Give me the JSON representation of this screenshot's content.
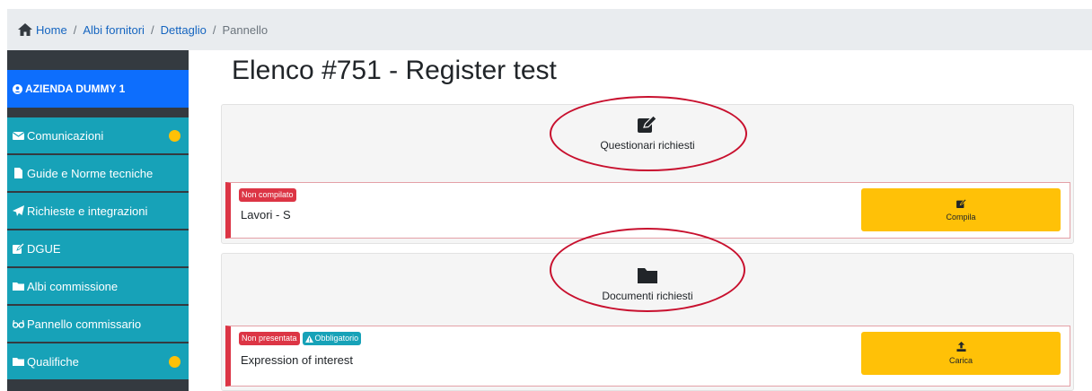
{
  "breadcrumb": {
    "home": "Home",
    "level1": "Albi fornitori",
    "level2": "Dettaglio",
    "current": "Pannello",
    "separator": "/"
  },
  "sidebar": {
    "company": "AZIENDA DUMMY 1",
    "items": [
      {
        "label": "Comunicazioni",
        "icon": "envelope-icon",
        "notification": true
      },
      {
        "label": "Guide e Norme tecniche",
        "icon": "file-icon",
        "notification": false
      },
      {
        "label": "Richieste e integrazioni",
        "icon": "paper-plane-icon",
        "notification": false
      },
      {
        "label": "DGUE",
        "icon": "edit-icon",
        "notification": false
      },
      {
        "label": "Albi commissione",
        "icon": "folder-icon",
        "notification": false
      },
      {
        "label": "Pannello commissario",
        "icon": "glasses-icon",
        "notification": false
      },
      {
        "label": "Qualifiche",
        "icon": "folder-icon",
        "notification": true
      }
    ]
  },
  "page": {
    "title": "Elenco #751 - Register test"
  },
  "questionnaires": {
    "heading": "Questionari richiesti",
    "icon": "edit-icon",
    "item": {
      "status_badge": "Non compilato",
      "label": "Lavori - S",
      "action_label": "Compila",
      "action_icon": "edit-icon"
    }
  },
  "documents": {
    "heading": "Documenti richiesti",
    "icon": "folder-icon",
    "item": {
      "status_badge": "Non presentata",
      "required_badge": "Obbligatorio",
      "label": "Expression of interest",
      "action_label": "Carica",
      "action_icon": "upload-icon"
    }
  },
  "colors": {
    "accent_blue": "#0d6efd",
    "sidebar_teal": "#17a2b8",
    "warning_yellow": "#ffc107",
    "danger_red": "#dc3545",
    "annotation_red": "#c8102e"
  }
}
